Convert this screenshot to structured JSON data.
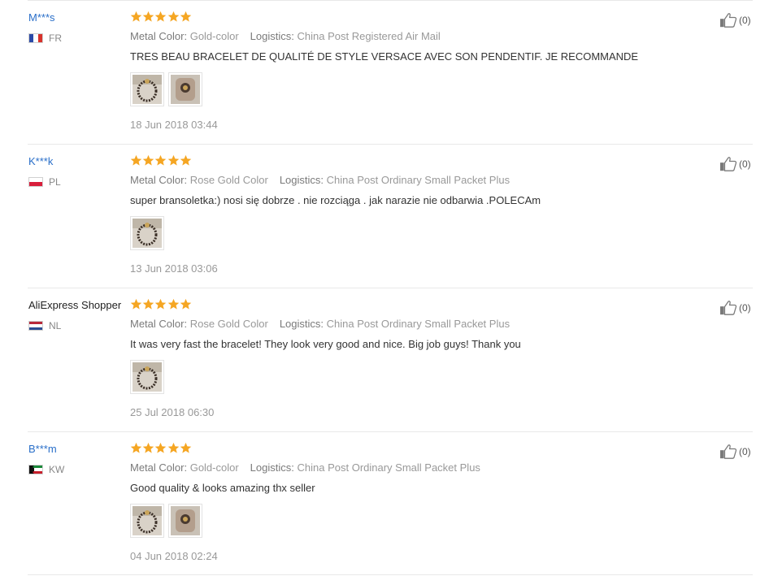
{
  "colors": {
    "star": "#f5a623",
    "user_link": "#2a6fc9",
    "meta": "#999999",
    "separator": "#e8e8e8"
  },
  "reviews": [
    {
      "user": "M***s",
      "user_is_link": true,
      "country": "FR",
      "flag": "flag-france",
      "stars": 5,
      "meta_color_label": "Metal Color:",
      "meta_color_value": "Gold-color",
      "meta_logistics_label": "Logistics:",
      "meta_logistics_value": "China Post Registered Air Mail",
      "text": "TRES BEAU BRACELET DE QUALITÉ DE STYLE VERSACE AVEC SON PENDENTIF. JE RECOMMANDE",
      "photos": [
        "bracelet-photo-1",
        "bracelet-photo-2"
      ],
      "date": "18 Jun 2018 03:44",
      "useful_count": "(0)"
    },
    {
      "user": "K***k",
      "user_is_link": true,
      "country": "PL",
      "flag": "flag-poland",
      "stars": 5,
      "meta_color_label": "Metal Color:",
      "meta_color_value": "Rose Gold Color",
      "meta_logistics_label": "Logistics:",
      "meta_logistics_value": "China Post Ordinary Small Packet Plus",
      "text": "super bransoletka:) nosi się dobrze . nie rozciąga . jak narazie nie odbarwia .POLECAm",
      "photos": [
        "bracelet-photo-1"
      ],
      "date": "13 Jun 2018 03:06",
      "useful_count": "(0)"
    },
    {
      "user": "AliExpress Shopper",
      "user_is_link": false,
      "country": "NL",
      "flag": "flag-netherlands",
      "stars": 5,
      "meta_color_label": "Metal Color:",
      "meta_color_value": "Rose Gold Color",
      "meta_logistics_label": "Logistics:",
      "meta_logistics_value": "China Post Ordinary Small Packet Plus",
      "text": "It was very fast the bracelet! They look very good and nice. Big job guys! Thank you",
      "photos": [
        "bracelet-photo-1"
      ],
      "date": "25 Jul 2018 06:30",
      "useful_count": "(0)"
    },
    {
      "user": "B***m",
      "user_is_link": true,
      "country": "KW",
      "flag": "flag-kuwait",
      "stars": 5,
      "meta_color_label": "Metal Color:",
      "meta_color_value": "Gold-color",
      "meta_logistics_label": "Logistics:",
      "meta_logistics_value": "China Post Ordinary Small Packet Plus",
      "text": "Good quality & looks amazing thx seller",
      "photos": [
        "bracelet-photo-1",
        "bracelet-photo-2"
      ],
      "date": "04 Jun 2018 02:24",
      "useful_count": "(0)"
    }
  ]
}
